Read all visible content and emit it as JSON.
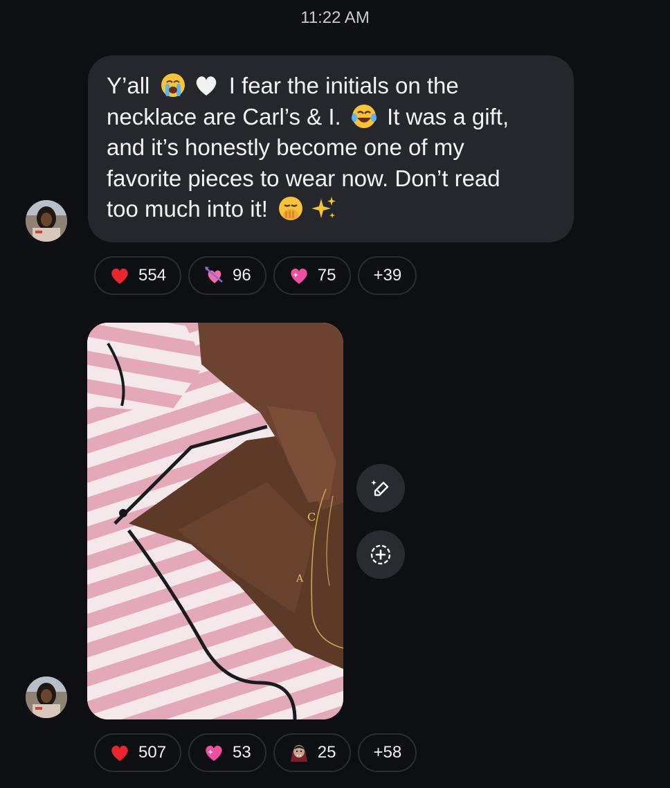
{
  "status": {
    "time": "11:22 AM"
  },
  "message1": {
    "lines": [
      [
        "Y’all",
        "I fear the initials on the"
      ],
      [
        "necklace are Carl’s & I.",
        "It was a gift,"
      ],
      [
        "and it’s honestly become one of my"
      ],
      [
        "favorite pieces to wear now. Don’t read"
      ],
      [
        "too much into it!"
      ]
    ],
    "emojis": [
      "loudly-crying-face",
      "white-heart",
      "face-with-tears-of-joy",
      "face-with-hand-over-mouth",
      "sparkles"
    ]
  },
  "reactions1": [
    {
      "emoji": "red-heart",
      "count": "554"
    },
    {
      "emoji": "heart-with-arrow",
      "count": "96"
    },
    {
      "emoji": "sparkling-heart",
      "count": "75"
    },
    {
      "more": "+39"
    }
  ],
  "message2": {
    "type": "photo",
    "actions": [
      "edit-magic-icon",
      "add-reaction-icon"
    ]
  },
  "reactions2": [
    {
      "emoji": "red-heart",
      "count": "507"
    },
    {
      "emoji": "sparkling-heart",
      "count": "53"
    },
    {
      "emoji": "vampire",
      "count": "25"
    },
    {
      "more": "+58"
    }
  ],
  "colors": {
    "background": "#0e0f13",
    "bubble": "#26272c",
    "pill_border": "#2c2d33"
  }
}
